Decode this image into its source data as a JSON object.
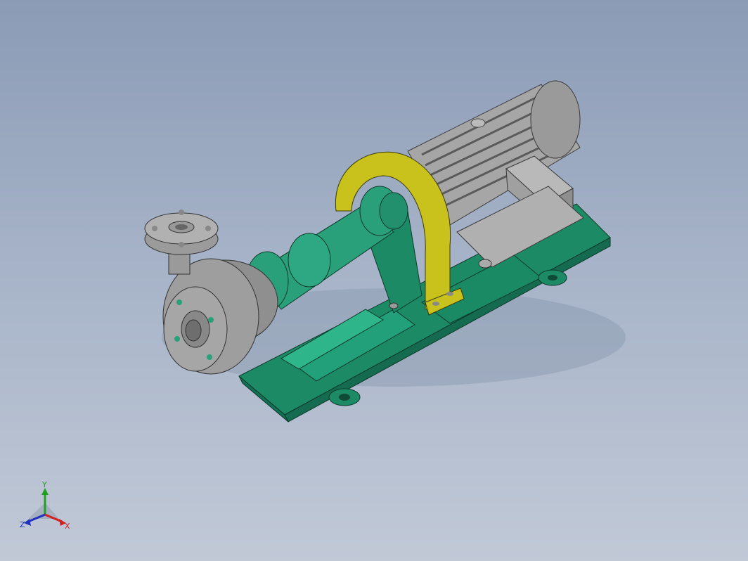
{
  "scene": {
    "model_name": "centrifugal-pump-with-motor",
    "colors": {
      "background_top": "#8b9bb6",
      "background_bottom": "#c1c9d7",
      "base_green": "#1f8f6a",
      "pump_green": "#2a9e78",
      "casing_gray": "#9b9b9b",
      "guard_yellow": "#c9c21c",
      "motor_gray": "#a8a8a8"
    }
  },
  "triad": {
    "x_label": "X",
    "y_label": "Y",
    "z_label": "Z",
    "x_color": "#d22020",
    "y_color": "#22a022",
    "z_color": "#2030c0"
  }
}
